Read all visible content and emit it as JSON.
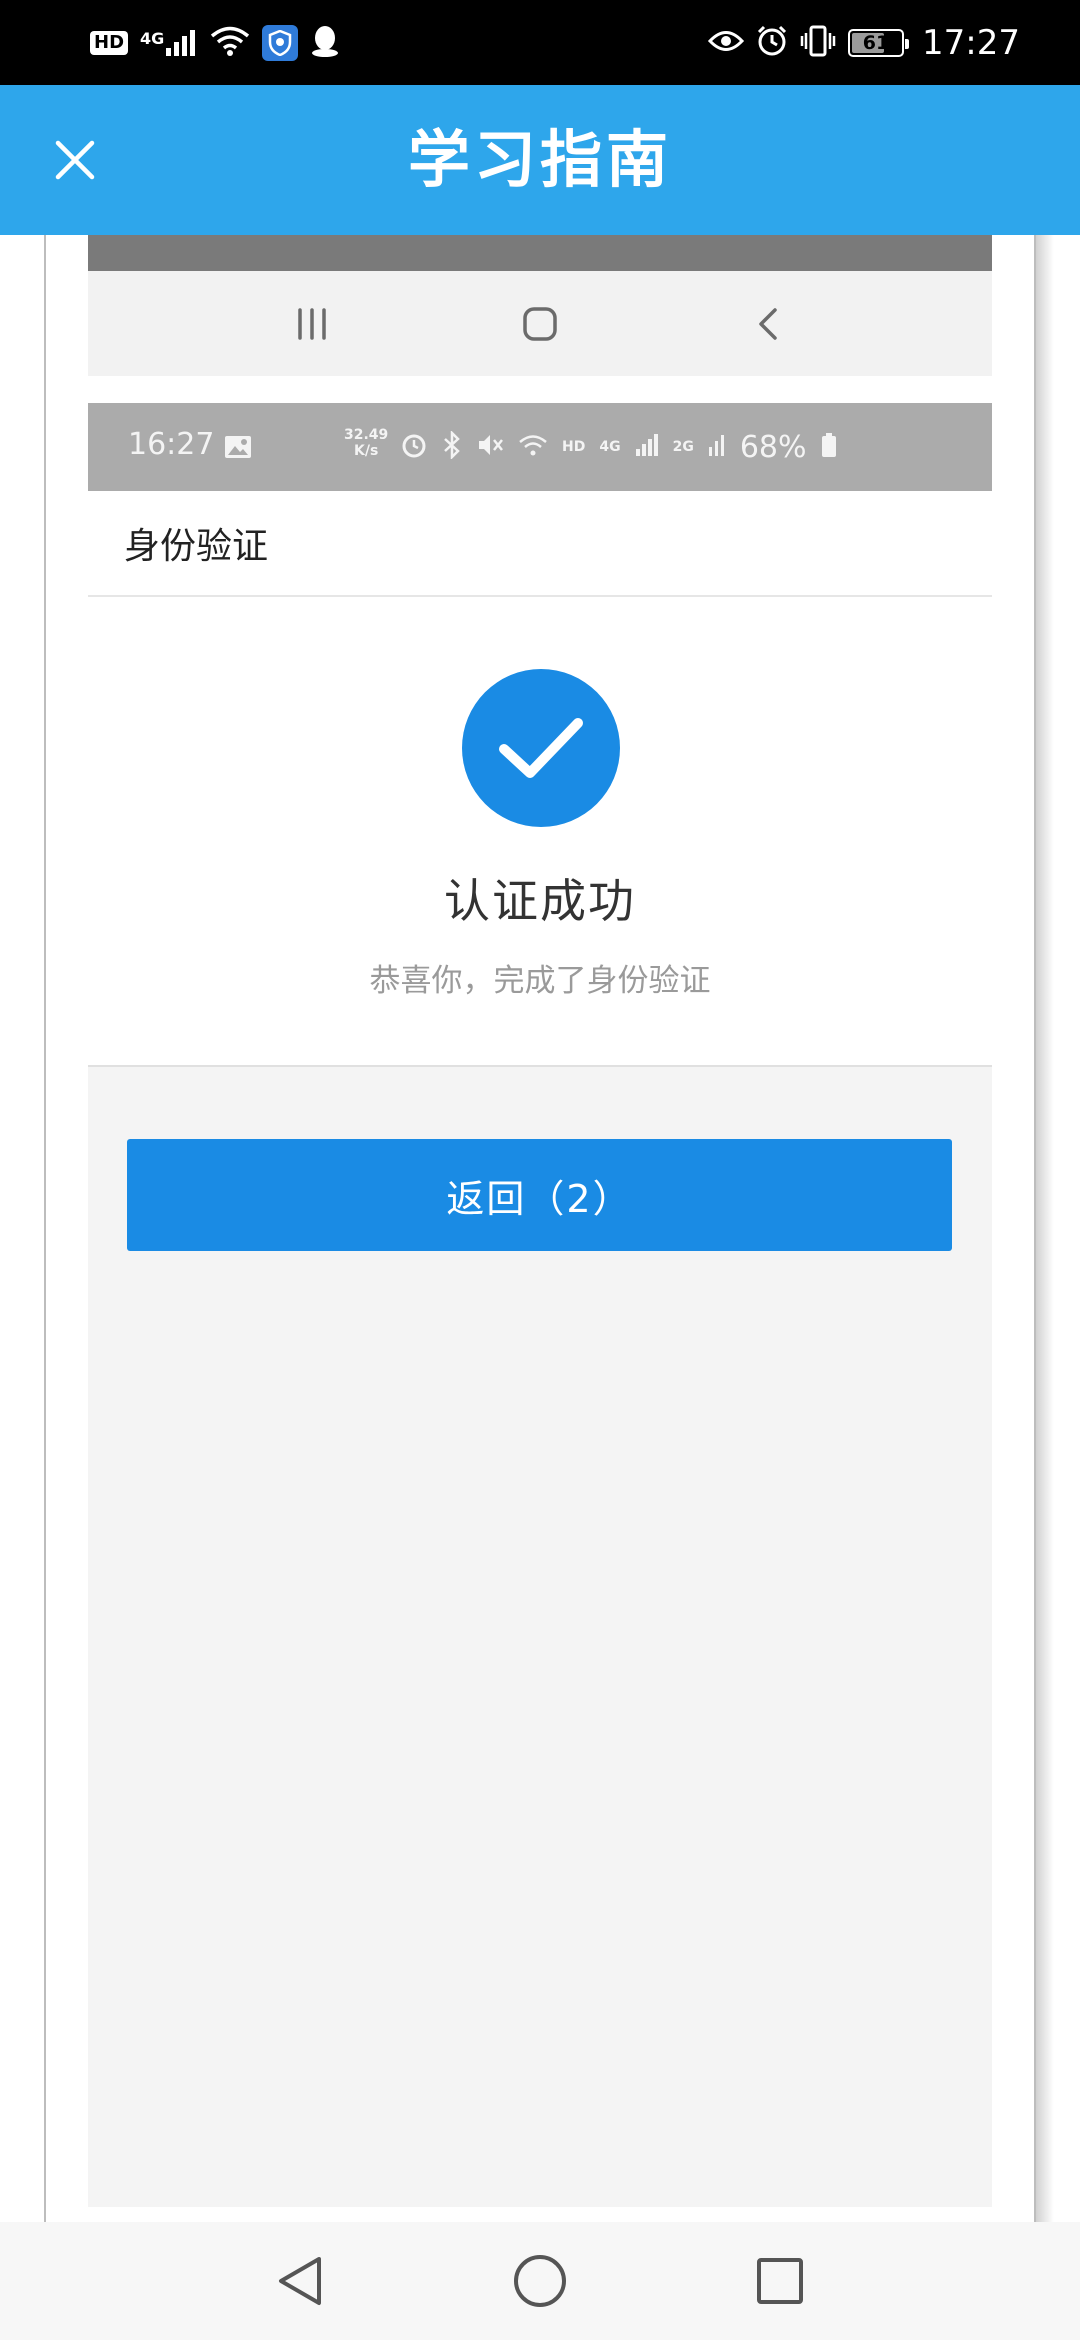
{
  "status_bar": {
    "hd": "HD",
    "network": "4G",
    "battery_level": "61",
    "time": "17:27"
  },
  "header": {
    "title": "学习指南"
  },
  "inner_status_bar": {
    "time": "16:27",
    "speed_value": "32.49",
    "speed_unit": "K/s",
    "hd": "HD",
    "network": "4G",
    "network2": "2G",
    "battery": "68%"
  },
  "page": {
    "title": "身份验证",
    "success_title": "认证成功",
    "success_subtitle": "恭喜你，完成了身份验证",
    "return_button": "返回（2）"
  },
  "colors": {
    "header_bg": "#2ea6eb",
    "accent": "#1a8be4",
    "status_bar_bg": "#000000",
    "page_bg": "#f4f4f4"
  },
  "icons": {
    "close": "close-icon",
    "check": "check-icon",
    "recents": "recents-icon",
    "home": "home-icon",
    "back": "back-icon"
  }
}
